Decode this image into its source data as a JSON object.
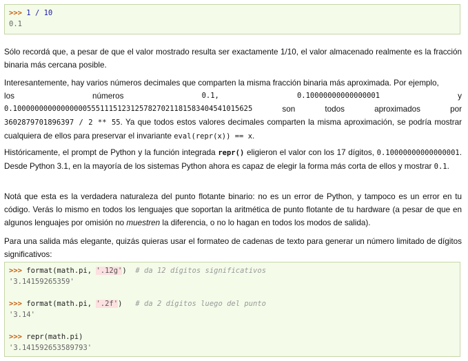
{
  "block1": {
    "prompt": ">>>",
    "input": "1 / 10",
    "output": "0.1"
  },
  "para1": "Sólo recordá que, a pesar de que el valor mostrado resulta ser exactamente 1/10, el valor almacenado realmente es la fracción binaria más cercana posible.",
  "para2": {
    "l1": "Interesantemente, hay varios números decimales que comparten la misma fracción binaria más aproximada. Por ejemplo,",
    "w_los": "los",
    "w_numeros": "números",
    "c1": "0.1,",
    "c2": "0.10000000000000001",
    "w_y": "y",
    "c3": "0.1000000000000000055511151231257827021181583404541015625",
    "w_son": "son",
    "w_todos": "todos",
    "w_aprox": "aproximados",
    "w_por": "por",
    "c4": "3602879701896397 / 2 ** 55",
    "t4": ". Ya que todos estos valores decimales comparten la misma aproximación, se podría mostrar cualquiera de ellos para preservar el invariante ",
    "c5": "eval(repr(x)) == x",
    "t5": "."
  },
  "para3": {
    "t1": "Históricamente, el prompt de Python y la función integrada ",
    "c1": "repr()",
    "t2": " eligieron el valor con los 17 dígitos, ",
    "c2": "0.10000000000000001",
    "t3": ". Desde Python 3.1, en la mayoría de los sistemas Python ahora es capaz de elegir la forma más corta de ellos y mostrar ",
    "c3": "0.1",
    "t4": "."
  },
  "para4": {
    "t1": "Notá que esta es la verdadera naturaleza del punto flotante binario: no es un error de Python, y tampoco es un error en tu código. Verás lo mismo en todos los lenguajes que soportan la aritmética de punto flotante de tu hardware (a pesar de que en algunos lenguajes por omisión no ",
    "em": "muestren",
    "t2": " la diferencia, o no lo hagan en todos los modos de salida)."
  },
  "para5": "Para una salida más elegante, quizás quieras usar el formateo de cadenas de texto para generar un número limitado de dígitos significativos:",
  "block2": {
    "prompt": ">>>",
    "l1_fn": "format(math.pi, ",
    "l1_str": "'.12g'",
    "l1_close": ")",
    "l1_cmt": "# da 12 dígitos significativos",
    "l1_out": "'3.14159265359'",
    "l2_fn": "format(math.pi, ",
    "l2_str": "'.2f'",
    "l2_close": ")",
    "l2_cmt": "# da 2 dígitos luego del punto",
    "l2_out": "'3.14'",
    "l3_fn": "repr(math.pi)",
    "l3_out": "'3.141592653589793'"
  }
}
